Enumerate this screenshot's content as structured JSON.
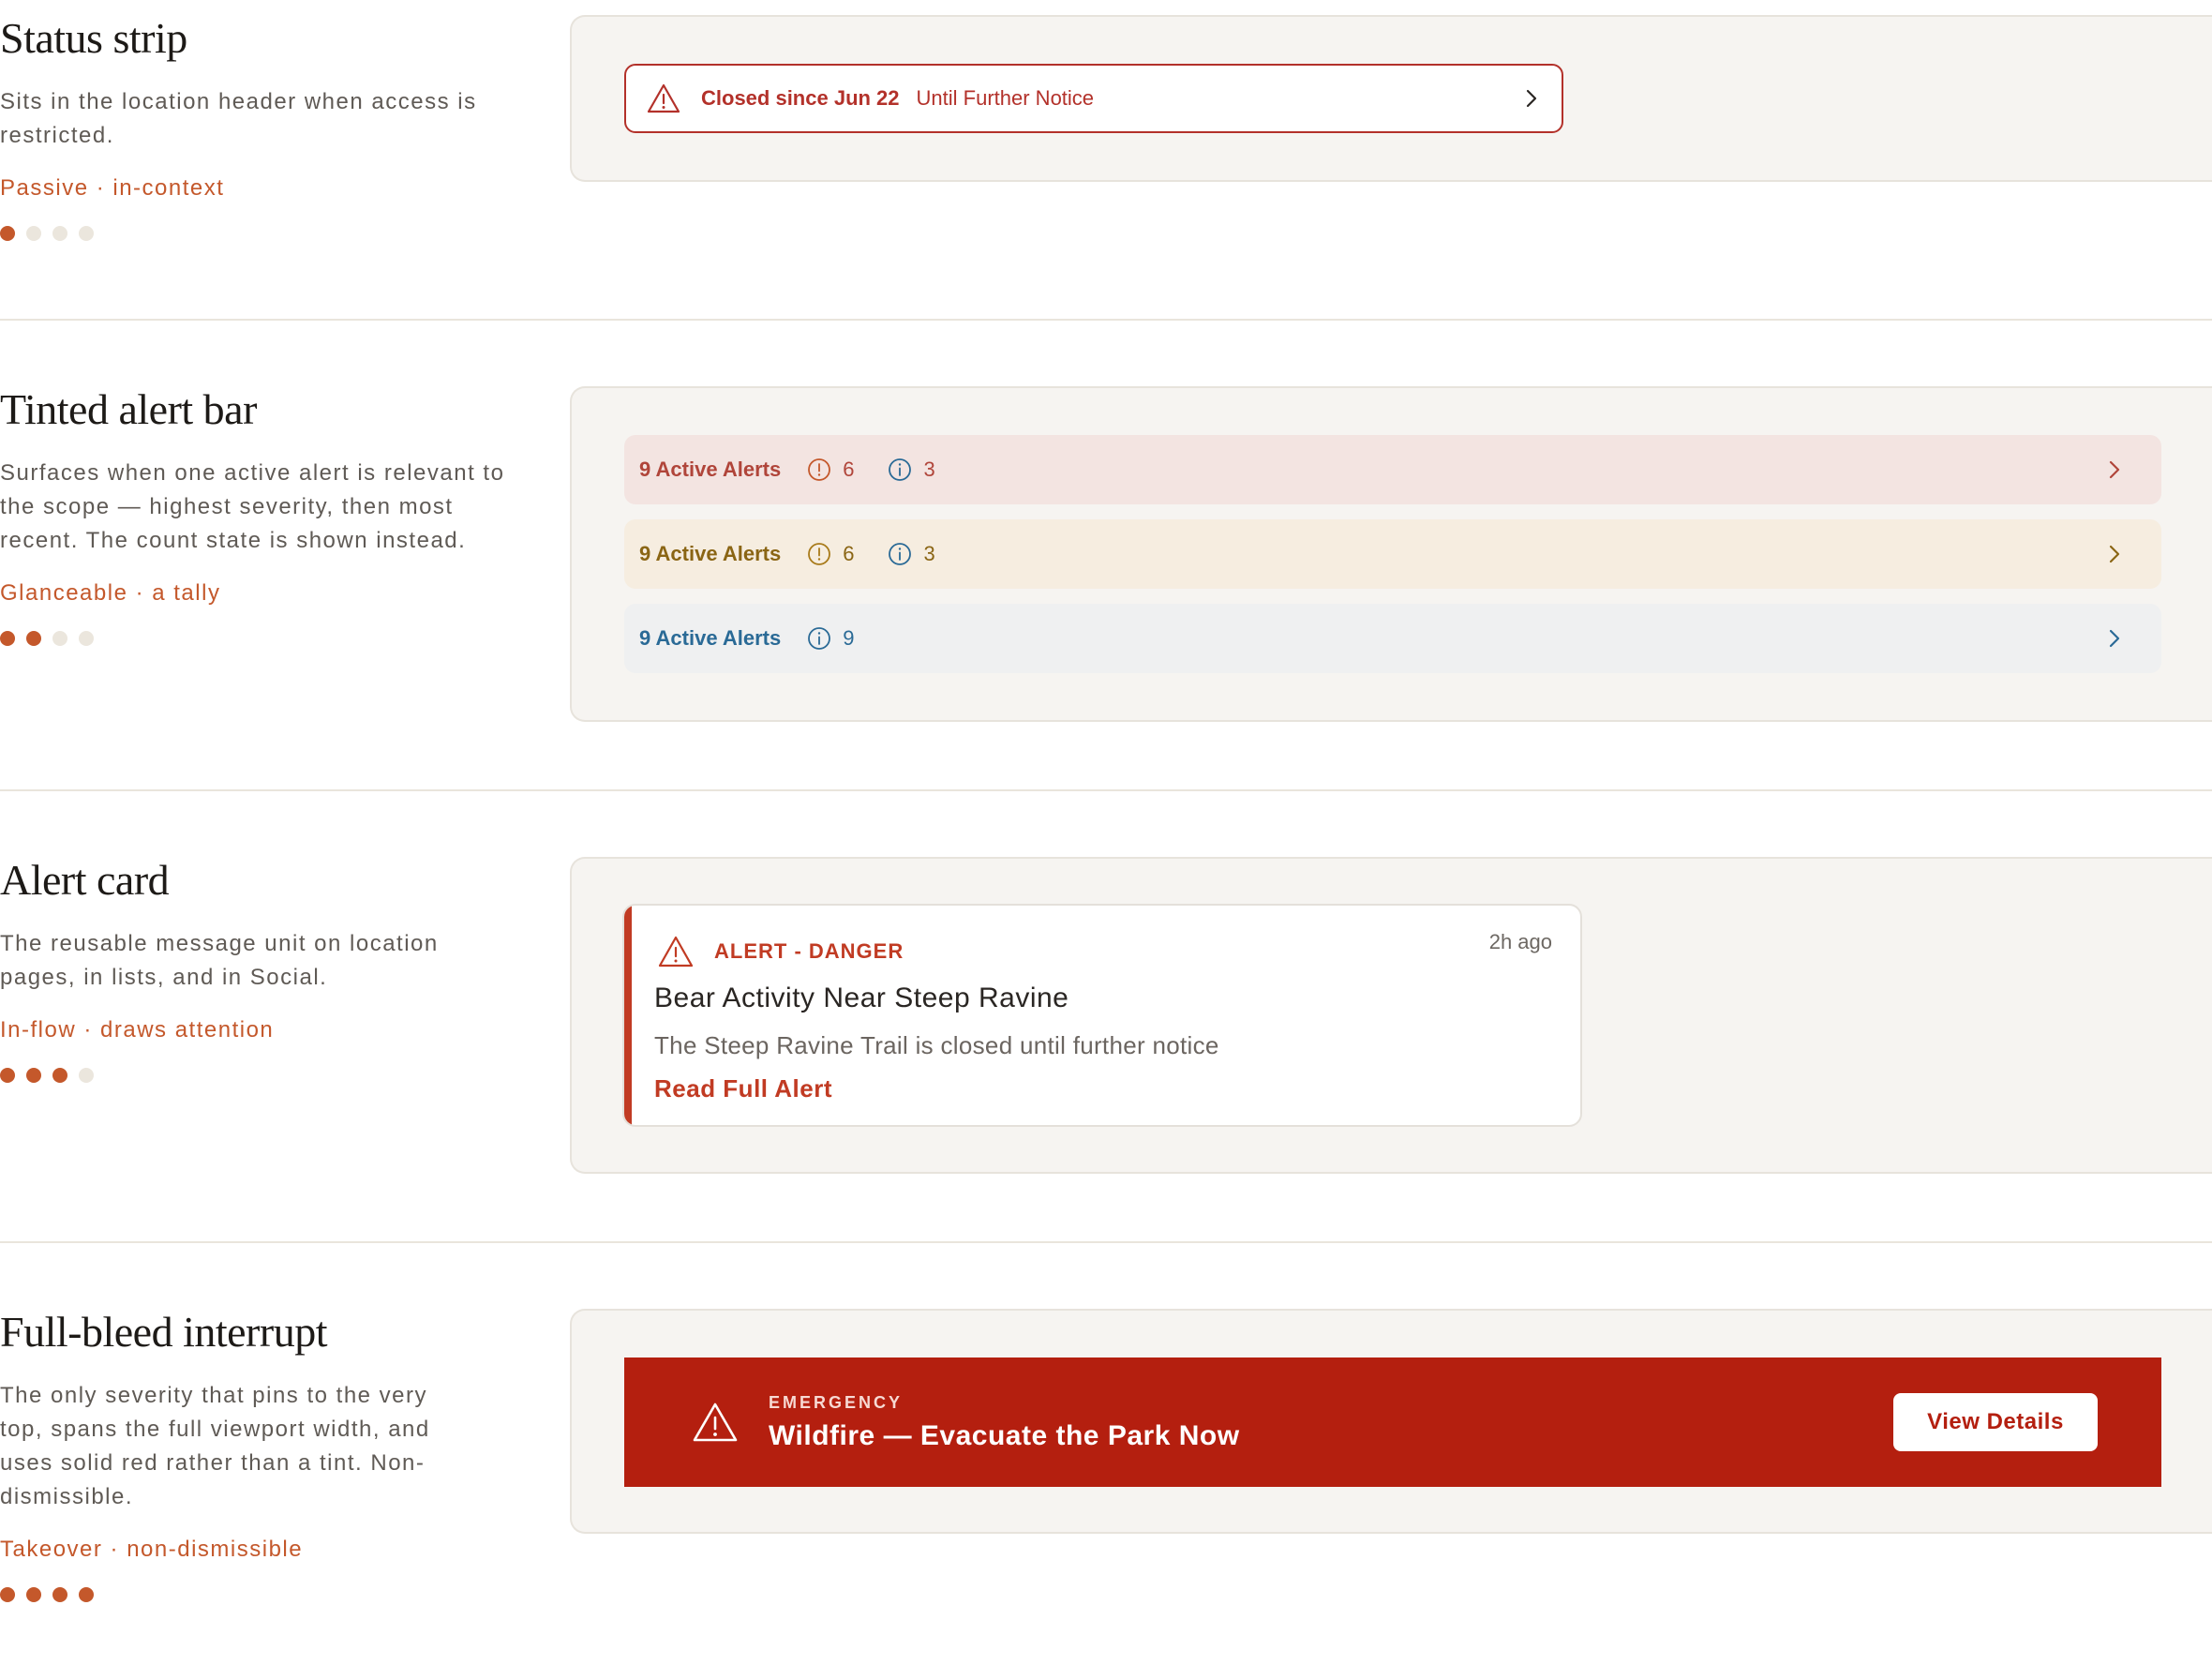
{
  "colors": {
    "accent": "#c4582b",
    "danger": "#b3312a",
    "emergency": "#b41f0f",
    "panel_bg": "#f6f4f1",
    "info_blue": "#2a6a96",
    "amber": "#8a6514"
  },
  "sections": [
    {
      "title": "Status strip",
      "description": "Sits in the location header when access is restricted.",
      "tag": "Passive · in-context",
      "level": 1,
      "dots_total": 4
    },
    {
      "title": "Tinted alert bar",
      "description": "Surfaces when one active alert is relevant to the scope — highest severity, then most recent. The count state is shown instead.",
      "tag": "Glanceable · a tally",
      "level": 2,
      "dots_total": 4
    },
    {
      "title": "Alert card",
      "description": "The reusable message unit on location pages, in lists, and in Social.",
      "tag": "In-flow · draws attention",
      "level": 3,
      "dots_total": 4
    },
    {
      "title": "Full-bleed interrupt",
      "description": "The only severity that pins to the very top, spans the full viewport width, and uses solid red rather than a tint. Non-dismissible.",
      "tag": "Takeover · non-dismissible",
      "level": 4,
      "dots_total": 4
    }
  ],
  "status_strip": {
    "icon": "warning-triangle-icon",
    "main": "Closed since Jun 22",
    "sub": "Until Further Notice",
    "chevron": "chevron-right-icon"
  },
  "tinted_bars": [
    {
      "variant": "danger",
      "label": "9 Active Alerts",
      "warning_count": "6",
      "info_count": "3"
    },
    {
      "variant": "warning",
      "label": "9 Active Alerts",
      "warning_count": "6",
      "info_count": "3"
    },
    {
      "variant": "info",
      "label": "9 Active Alerts",
      "info_count": "9"
    }
  ],
  "alert_card": {
    "icon": "warning-triangle-icon",
    "kicker": "ALERT - DANGER",
    "time": "2h ago",
    "title": "Bear Activity Near Steep Ravine",
    "body": "The Steep Ravine Trail is closed until further notice",
    "link": "Read Full Alert"
  },
  "full_bleed": {
    "icon": "warning-triangle-icon",
    "kicker": "EMERGENCY",
    "title": "Wildfire — Evacuate the Park Now",
    "button": "View Details"
  }
}
